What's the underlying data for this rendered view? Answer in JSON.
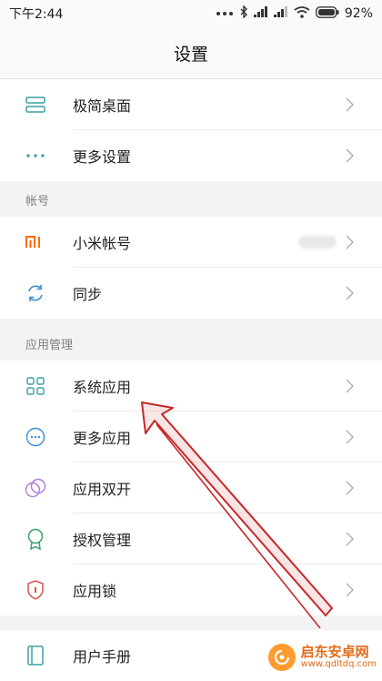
{
  "status_bar": {
    "time": "下午2:44",
    "battery": "92%"
  },
  "header": {
    "title": "设置"
  },
  "group1": {
    "items": [
      {
        "label": "极简桌面",
        "icon": "minimal-desktop-icon"
      },
      {
        "label": "更多设置",
        "icon": "more-dots-icon"
      }
    ]
  },
  "section_account": {
    "label": "帐号",
    "items": [
      {
        "label": "小米帐号",
        "icon": "mi-logo-icon"
      },
      {
        "label": "同步",
        "icon": "sync-icon"
      }
    ]
  },
  "section_apps": {
    "label": "应用管理",
    "items": [
      {
        "label": "系统应用",
        "icon": "grid-apps-icon"
      },
      {
        "label": "更多应用",
        "icon": "more-apps-icon"
      },
      {
        "label": "应用双开",
        "icon": "dual-apps-icon"
      },
      {
        "label": "授权管理",
        "icon": "permission-badge-icon"
      },
      {
        "label": "应用锁",
        "icon": "shield-lock-icon"
      }
    ]
  },
  "group_last": {
    "items": [
      {
        "label": "用户手册",
        "icon": "manual-book-icon"
      }
    ]
  },
  "watermark": {
    "main": "启东安卓网",
    "sub": "www.qdltdq.com"
  },
  "colors": {
    "accent_teal": "#3aa0a6",
    "mi_orange": "#ff6a00",
    "annotation_red": "#c62828"
  }
}
